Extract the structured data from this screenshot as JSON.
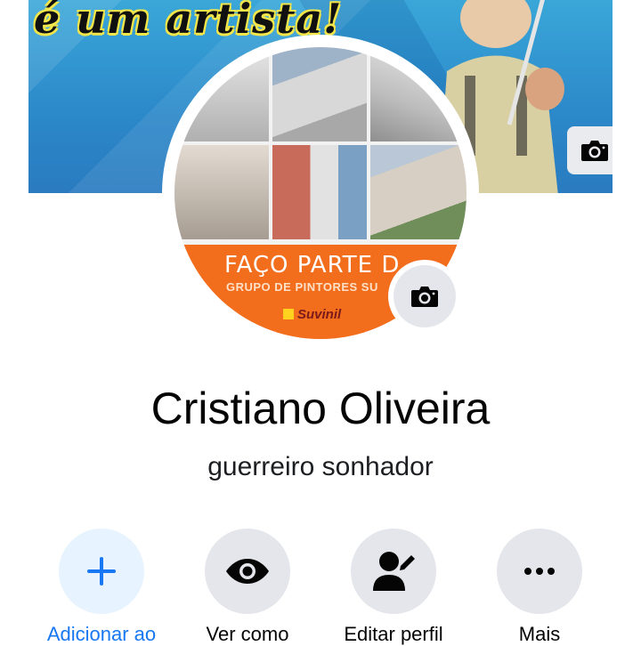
{
  "cover": {
    "headline": "é um artista!",
    "camera_icon": "camera-icon"
  },
  "avatar": {
    "banner_line1": "FAÇO PARTE D",
    "banner_line2": "GRUPO DE PINTORES SU",
    "brand": "Suvinil",
    "camera_icon": "camera-icon"
  },
  "profile": {
    "name": "Cristiano Oliveira",
    "bio": "guerreiro sonhador"
  },
  "actions": [
    {
      "label": "Adicionar ao",
      "icon": "plus-icon"
    },
    {
      "label": "Ver como",
      "icon": "eye-icon"
    },
    {
      "label": "Editar perfil",
      "icon": "edit-profile-icon"
    },
    {
      "label": "Mais",
      "icon": "more-icon"
    }
  ],
  "colors": {
    "accent": "#1877f2",
    "button_bg": "#e4e6eb",
    "primary_button_bg": "#e7f3ff",
    "banner_orange": "#f26d1c"
  }
}
